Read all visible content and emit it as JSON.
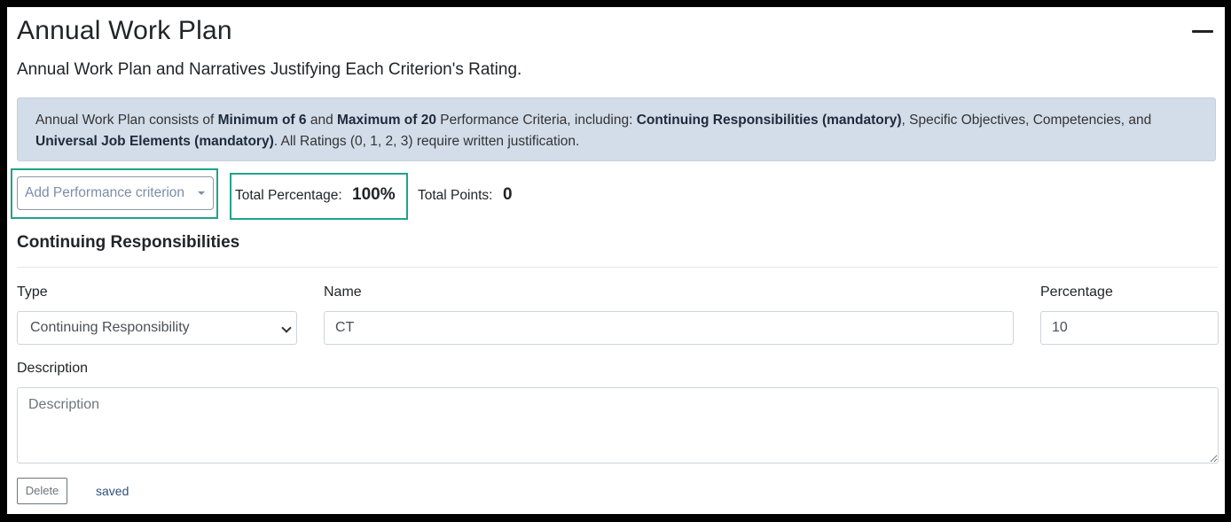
{
  "header": {
    "title": "Annual Work Plan",
    "subtitle": "Annual Work Plan and Narratives Justifying Each Criterion's Rating.",
    "collapse_icon": "minus-icon"
  },
  "info": {
    "t1": "Annual Work Plan consists of ",
    "b1": "Minimum of 6",
    "t2": " and ",
    "b2": "Maximum of 20",
    "t3": " Performance Criteria, including: ",
    "b3": "Continuing Responsibilities (mandatory)",
    "t4": ", Specific Objectives, Competencies, and ",
    "b4": "Universal Job Elements (mandatory)",
    "t5": ". All Ratings (0, 1, 2, 3) require written justification."
  },
  "toolbar": {
    "add_button_label": "Add Performance criterion",
    "total_percentage_label": "Total Percentage:",
    "total_percentage_value": "100%",
    "total_points_label": "Total Points:",
    "total_points_value": "0",
    "highlight_color": "#20a38a"
  },
  "section": {
    "title": "Continuing Responsibilities",
    "type_label": "Type",
    "type_value": "Continuing Responsibility",
    "name_label": "Name",
    "name_value": "CT",
    "percentage_label": "Percentage",
    "percentage_value": "10",
    "description_label": "Description",
    "description_placeholder": "Description",
    "delete_label": "Delete",
    "status": "saved"
  }
}
